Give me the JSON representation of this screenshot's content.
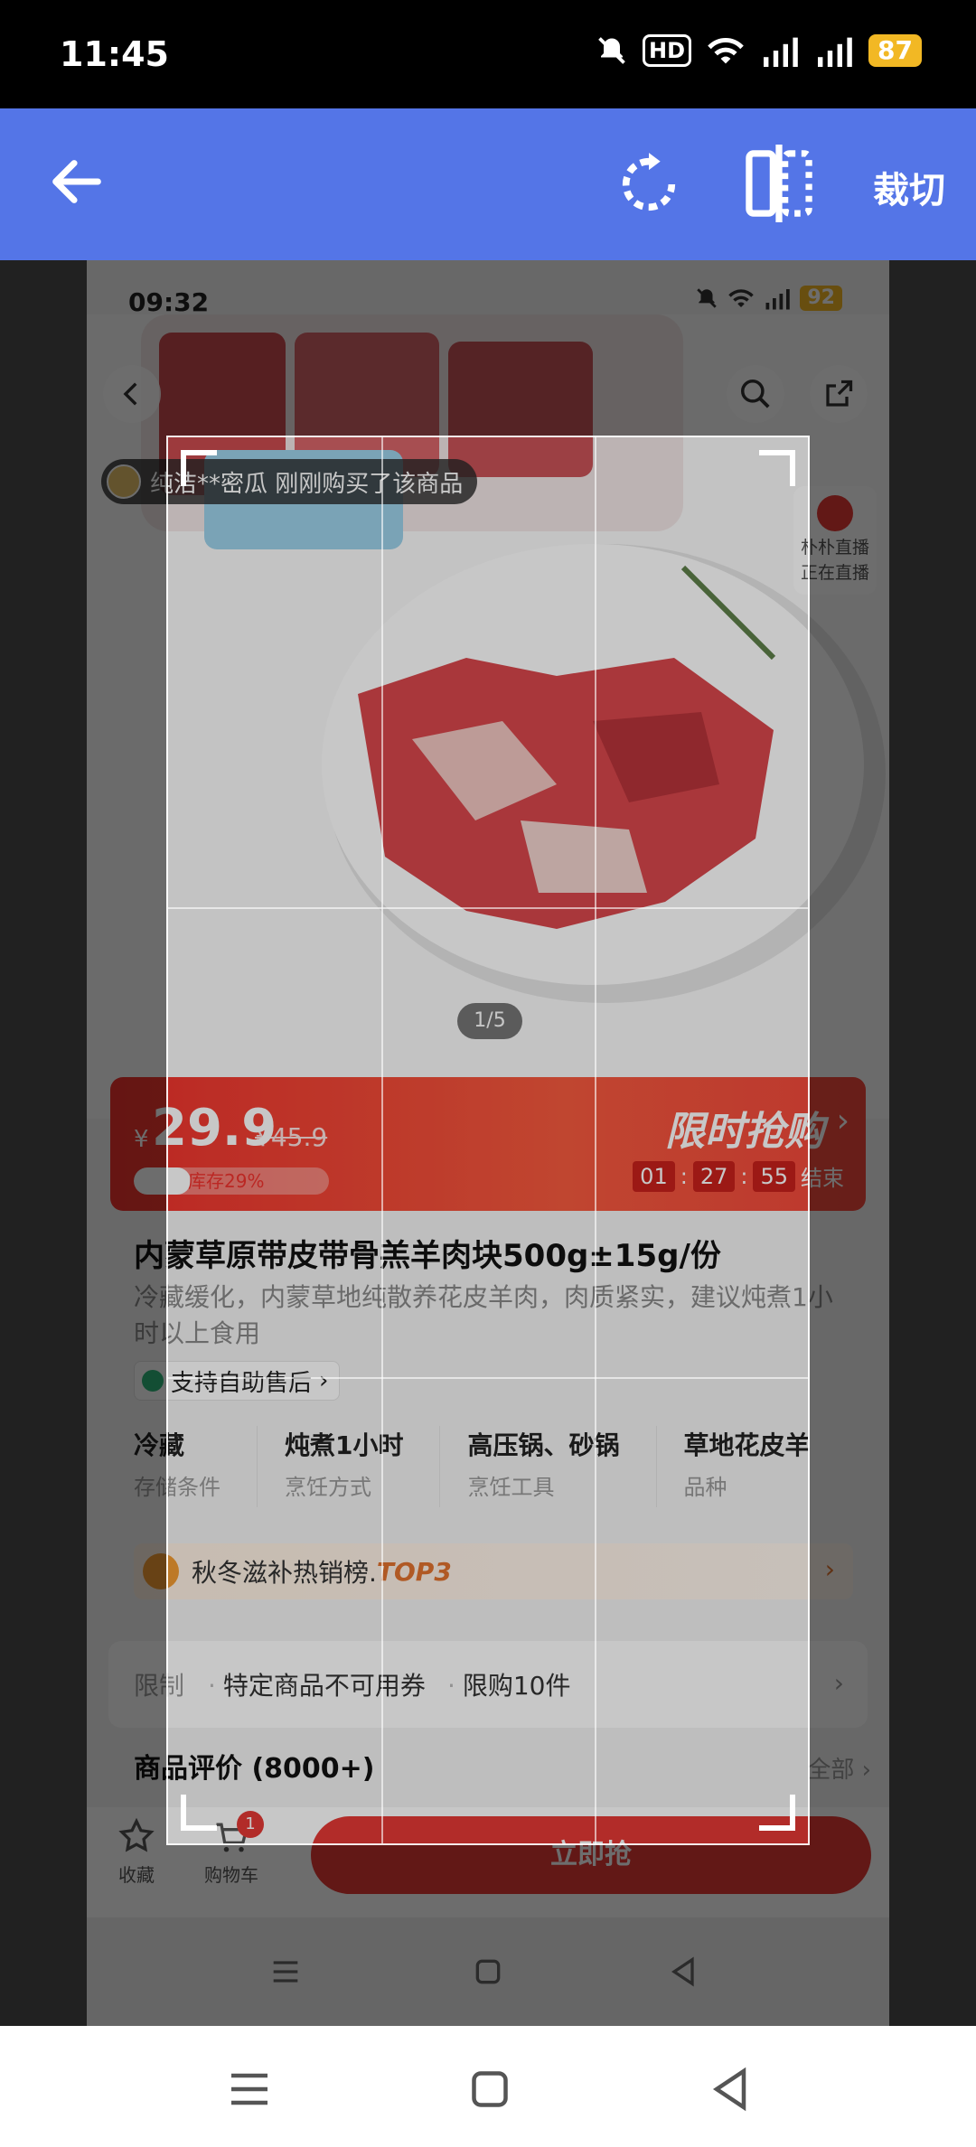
{
  "status_bar": {
    "time": "11:45",
    "battery": "87",
    "hd": "HD"
  },
  "toolbar": {
    "crop_label": "裁切"
  },
  "inner": {
    "status": {
      "time": "09:32",
      "battery": "92"
    },
    "buyer_ticker": "纯洁**密瓜 刚刚购买了该商品",
    "live": {
      "line1": "朴朴直播",
      "line2": "正在直播"
    },
    "page_indicator": "1/5",
    "price": {
      "currency": "¥",
      "now": "29.9",
      "original": "¥45.9",
      "stock_label": "库存29%",
      "stock_fraction": 0.29,
      "flash_title": "限时抢购",
      "countdown": {
        "h": "01",
        "m": "27",
        "s": "55",
        "suffix": "结束"
      }
    },
    "title": "内蒙草原带皮带骨羔羊肉块500g±15g/份",
    "subtitle": "冷藏缓化，内蒙草地纯散养花皮羊肉，肉质紧实，建议炖煮1小时以上食用",
    "aftersale": "支持自助售后",
    "attributes": [
      {
        "value": "冷藏",
        "key": "存储条件"
      },
      {
        "value": "炖煮1小时",
        "key": "烹饪方式"
      },
      {
        "value": "高压锅、砂锅",
        "key": "烹饪工具"
      },
      {
        "value": "草地花皮羊",
        "key": "品种"
      }
    ],
    "rank": {
      "text": "秋冬滋补热销榜.",
      "top": "TOP3"
    },
    "limits": {
      "label": "限制",
      "items": [
        "特定商品不可用券",
        "限购10件"
      ]
    },
    "review": {
      "title": "商品评价 (8000+)",
      "all": "全部"
    },
    "bottom": {
      "fav": "收藏",
      "cart": "购物车",
      "cart_count": "1",
      "buy": "立即抢"
    }
  }
}
